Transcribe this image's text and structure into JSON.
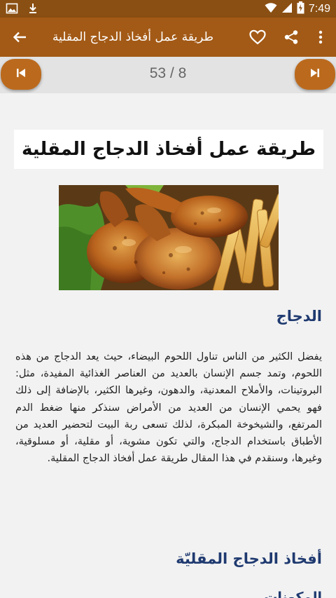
{
  "status_bar": {
    "time": "7:49",
    "icons": [
      "image-icon",
      "download-icon",
      "wifi-icon",
      "signal-icon",
      "battery-icon"
    ]
  },
  "app_bar": {
    "title": "طريقة عمل أفخاذ الدجاج المقلية",
    "icons": [
      "back-arrow-icon",
      "heart-icon",
      "share-icon",
      "more-vert-icon"
    ],
    "color": "#a35a16"
  },
  "pager": {
    "text": "53 / 8",
    "prev_icon": "skip-previous-icon",
    "next_icon": "skip-next-icon",
    "button_color": "#bb6a1d"
  },
  "article": {
    "title": "طريقة عمل أفخاذ الدجاج المقلية",
    "image_alt": "fried-chicken-drumsticks-photo",
    "section1_heading": "الدجاج",
    "section1_paragraph": "يفضل الكثير من الناس تناول اللحوم البيضاء، حيث يعد الدجاج من هذه اللحوم، وتمد جسم الإنسان بالعديد من العناصر الغذائية المفيدة، مثل: البروتينات، والأملاح المعدنية، والدهون، وغيرها الكثير، بالإضافة إلى ذلك فهو يحمي الإنسان من العديد من الأمراض سنذكر منها ضغط الدم المرتفع، والشيخوخة المبكرة، لذلك تسعى ربة البيت لتحضير العديد من الأطباق باستخدام الدجاج، والتي تكون مشوية، أو مقلية، أو مسلوقية، وغيرها، وسنقدم في هذا المقال طريقة عمل أفخاذ الدجاج المقلية.",
    "section2_heading": "أفخاذ الدجاج المقليّة",
    "section3_partial": "المكونات"
  }
}
